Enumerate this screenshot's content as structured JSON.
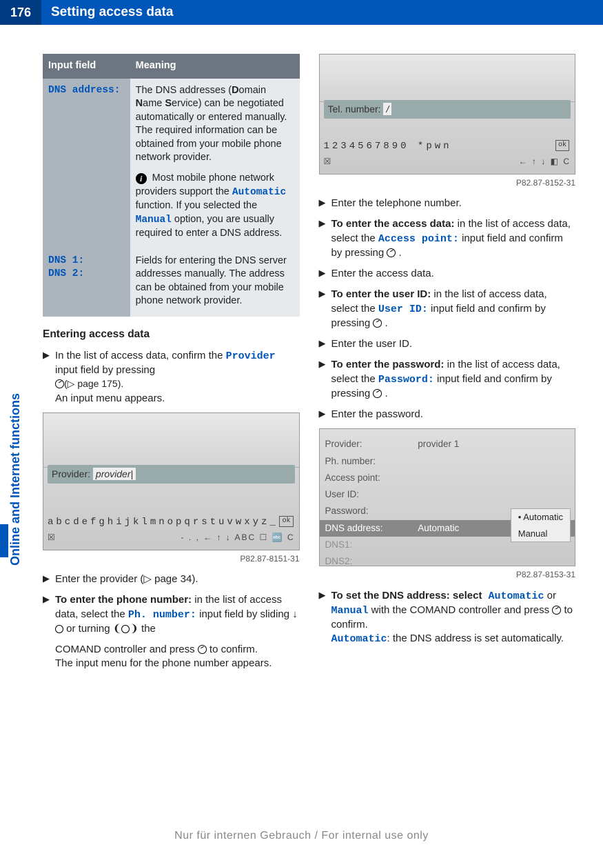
{
  "header": {
    "page_number": "176",
    "title": "Setting access data"
  },
  "sidebar": {
    "label": "Online and Internet functions"
  },
  "table": {
    "col1": "Input field",
    "col2": "Meaning",
    "rows": [
      {
        "field": "DNS address:",
        "meaning_pre": "The DNS addresses (",
        "meaning_d": "D",
        "meaning_mid1": "omain ",
        "meaning_n": "N",
        "meaning_mid2": "ame ",
        "meaning_s": "S",
        "meaning_post": "ervice) can be negotiated automatically or entered manually. The required information can be obtained from your mobile phone network provider.",
        "note_pre": "Most mobile phone network providers support the ",
        "note_auto": "Automatic",
        "note_mid": " function. If you selected the ",
        "note_manual": "Manual",
        "note_post": " option, you are usually required to enter a DNS address."
      },
      {
        "field": "DNS 1:",
        "field2": "DNS 2:",
        "meaning": "Fields for entering the DNS server addresses manually. The address can be obtained from your mobile phone network provider."
      }
    ]
  },
  "sections": {
    "entering_heading": "Entering access data",
    "step1_pre": "In the list of access data, confirm the ",
    "step1_mono": "Provider",
    "step1_mid": " input field by pressing ",
    "step1_post": "(▷ page 175).",
    "step1_line2": "An input menu appears.",
    "img1": {
      "field_label": "Provider:",
      "field_value": "provider|",
      "kb": "abcdefghijklmnopqrstuvwxyz_",
      "ok": "ok",
      "bottom_left": "☒",
      "bottom_right": "- . , ← ↑ ↓  ABC  ☐  🔤  C",
      "caption": "P82.87-8151-31"
    },
    "step2": "Enter the provider (▷ page 34).",
    "step3_bold": "To enter the phone number:",
    "step3_pre": " in the list of access data, select the ",
    "step3_mono": "Ph. number:",
    "step3_mid": " input field by sliding ",
    "step3_or": " or turning ",
    "step3_post": " the",
    "col2_top1": "COMAND controller and press ",
    "col2_top1_post": " to confirm.",
    "col2_top2": "The input menu for the phone number appears.",
    "img2": {
      "field_label": "Tel. number:",
      "field_value": "/",
      "kb": "1234567890    *pwn",
      "ok": "ok",
      "bottom_left": "☒",
      "bottom_right": "← ↑ ↓  ◧  C",
      "caption": "P82.87-8152-31"
    },
    "step4": "Enter the telephone number.",
    "step5_bold": "To enter the access data:",
    "step5_pre": " in the list of access data, select the ",
    "step5_mono": "Access point:",
    "step5_mid": " input field and confirm by pressing ",
    "step5_post": " .",
    "step6": "Enter the access data.",
    "step7_bold": "To enter the user ID:",
    "step7_pre": " in the list of access data, select the ",
    "step7_mono": "User ID:",
    "step7_mid": " input field and confirm by pressing ",
    "step7_post": " .",
    "step8": "Enter the user ID.",
    "step9_bold": "To enter the password:",
    "step9_pre": " in the list of access data, select the ",
    "step9_mono": "Password:",
    "step9_mid": " input field and confirm by pressing ",
    "step9_post": " .",
    "step10": "Enter the password.",
    "img3": {
      "rows": [
        {
          "lab": "Provider:",
          "val": "provider 1"
        },
        {
          "lab": "Ph. number:",
          "val": ""
        },
        {
          "lab": "Access point:",
          "val": ""
        },
        {
          "lab": "User ID:",
          "val": ""
        },
        {
          "lab": "Password:",
          "val": ""
        },
        {
          "lab": "DNS address:",
          "val": "Automatic",
          "sel": true
        },
        {
          "lab": "DNS1:",
          "val": ""
        },
        {
          "lab": "DNS2:",
          "val": ""
        }
      ],
      "opt1": "• Automatic",
      "opt2": "  Manual",
      "caption": "P82.87-8153-31"
    },
    "step11_bold": "To set the DNS address: select",
    "step11_mono1": " Automatic",
    "step11_or": " or ",
    "step11_mono2": "Manual",
    "step11_mid": " with the COMAND controller and press ",
    "step11_post": " to confirm.",
    "step11_line2_mono": "Automatic",
    "step11_line2_post": ": the DNS address is set automatically."
  },
  "footer": "Nur für internen Gebrauch / For internal use only"
}
